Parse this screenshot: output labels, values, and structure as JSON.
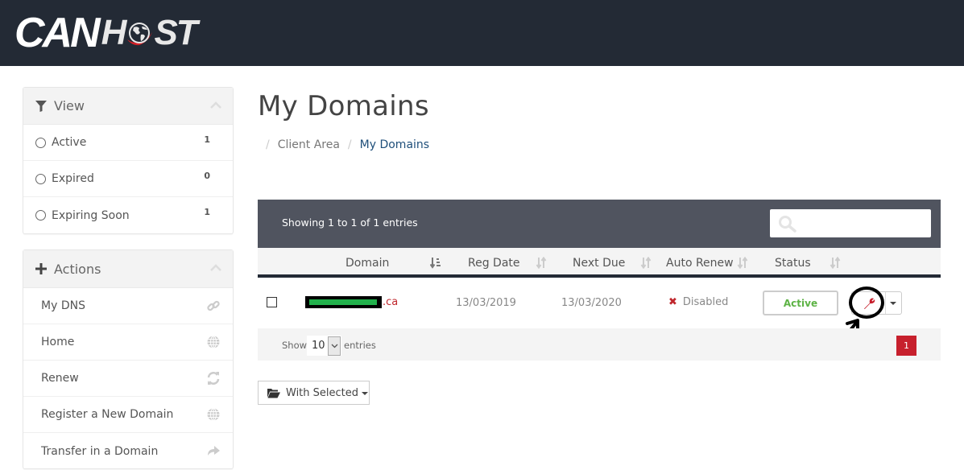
{
  "header": {
    "logo_left": "CAN",
    "logo_right_a": "H",
    "logo_right_b": "ST",
    "logo_accent_color": "#d42027"
  },
  "sidebar": {
    "view_panel": {
      "title": "View",
      "icon": "filter-icon",
      "items": [
        {
          "label": "Active",
          "count": "1"
        },
        {
          "label": "Expired",
          "count": "0"
        },
        {
          "label": "Expiring Soon",
          "count": "1"
        }
      ]
    },
    "actions_panel": {
      "title": "Actions",
      "icon": "plus-icon",
      "items": [
        {
          "label": "My DNS",
          "icon": "link-icon"
        },
        {
          "label": "Home",
          "icon": "globe-icon"
        },
        {
          "label": "Renew",
          "icon": "refresh-icon"
        },
        {
          "label": "Register a New Domain",
          "icon": "globe-icon"
        },
        {
          "label": "Transfer in a Domain",
          "icon": "share-arrow-icon"
        }
      ]
    }
  },
  "main": {
    "title": "My Domains",
    "breadcrumb": [
      {
        "label": "Client Area"
      },
      {
        "label": "My Domains"
      }
    ],
    "table": {
      "info": "Showing 1 to 1 of 1 entries",
      "search_placeholder": "",
      "columns": [
        "Domain",
        "Reg Date",
        "Next Due",
        "Auto Renew",
        "Status"
      ],
      "rows": [
        {
          "domain_tld": ".ca",
          "reg_date": "13/03/2019",
          "next_due": "13/03/2020",
          "auto_renew": "Disabled",
          "status": "Active"
        }
      ],
      "footer": {
        "show_label": "Show",
        "page_size": "10",
        "entries_label": "entries",
        "current_page": "1"
      }
    },
    "with_selected_label": "With Selected"
  },
  "colors": {
    "header_bg": "#232a35",
    "table_bar_bg": "#50545f",
    "accent_red": "#c7202d",
    "status_active": "#5db345",
    "breadcrumb_active": "#1f4f7a"
  }
}
